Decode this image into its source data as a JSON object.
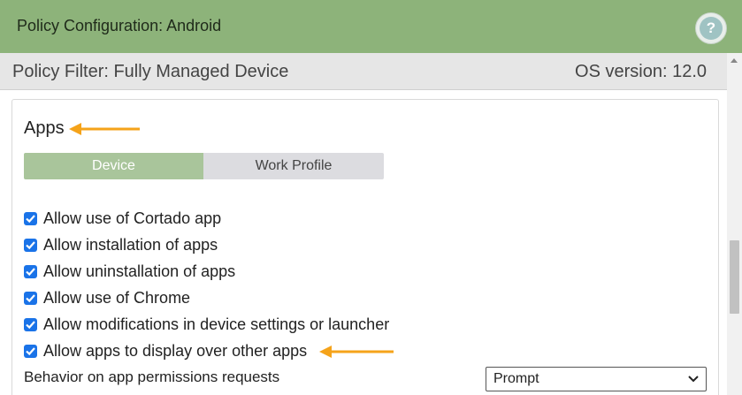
{
  "header": {
    "title": "Policy Configuration: Android",
    "help_icon_glyph": "?"
  },
  "filter_bar": {
    "filter": "Policy Filter: Fully Managed Device",
    "os_version": "OS version: 12.0"
  },
  "section": {
    "title": "Apps"
  },
  "tabs": [
    {
      "label": "Device",
      "active": true
    },
    {
      "label": "Work Profile",
      "active": false
    }
  ],
  "options": [
    {
      "label": "Allow use of Cortado app",
      "checked": true
    },
    {
      "label": "Allow installation of apps",
      "checked": true
    },
    {
      "label": "Allow uninstallation of apps",
      "checked": true
    },
    {
      "label": "Allow use of Chrome",
      "checked": true
    },
    {
      "label": "Allow modifications in device settings or launcher",
      "checked": true
    },
    {
      "label": "Allow apps to display over other apps",
      "checked": true
    }
  ],
  "permissions": {
    "label": "Behavior on app permissions requests",
    "value": "Prompt"
  },
  "colors": {
    "header_green": "#8db37a",
    "active_tab": "#a9c59b",
    "checkbox_blue": "#1a73e8",
    "annotation_arrow": "#f5a31a"
  }
}
